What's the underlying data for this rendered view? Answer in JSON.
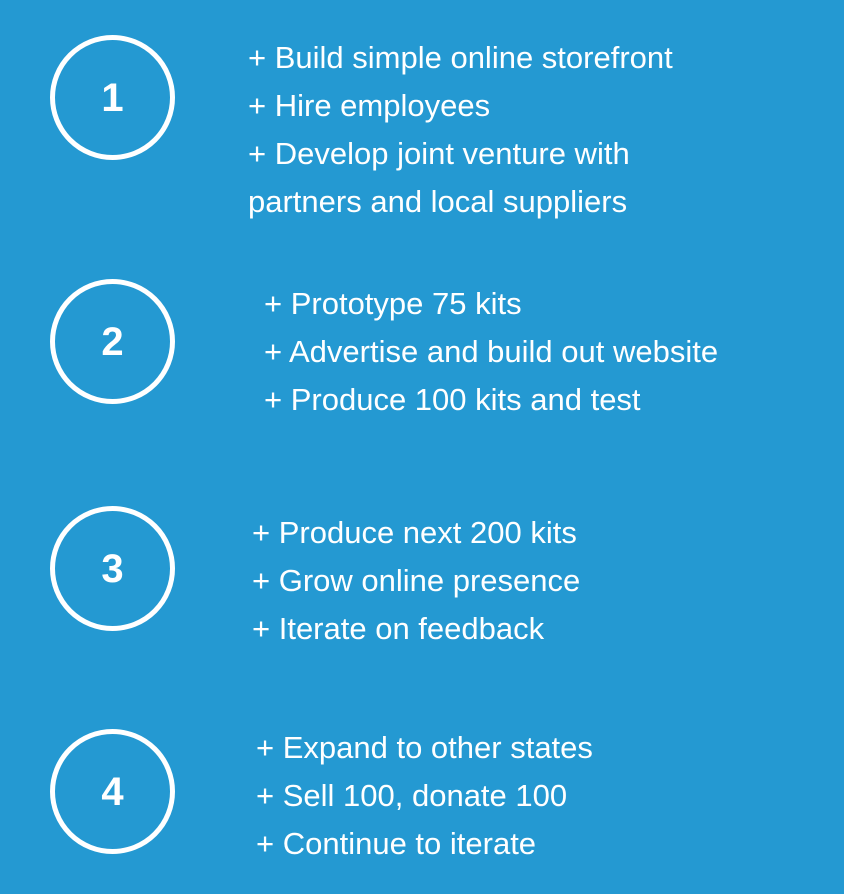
{
  "colors": {
    "background": "#2499d2",
    "foreground": "#ffffff"
  },
  "steps": [
    {
      "number": "1",
      "lines": [
        "+ Build simple online storefront",
        "+ Hire employees",
        "+ Develop joint venture with",
        "partners and local suppliers"
      ]
    },
    {
      "number": "2",
      "lines": [
        "+ Prototype 75 kits",
        "+ Advertise and build out website",
        "+ Produce 100 kits and test"
      ]
    },
    {
      "number": "3",
      "lines": [
        "+ Produce next 200 kits",
        "+ Grow online presence",
        "+ Iterate on feedback"
      ]
    },
    {
      "number": "4",
      "lines": [
        "+ Expand to other states",
        "+ Sell 100, donate 100",
        "+ Continue to iterate"
      ]
    }
  ]
}
